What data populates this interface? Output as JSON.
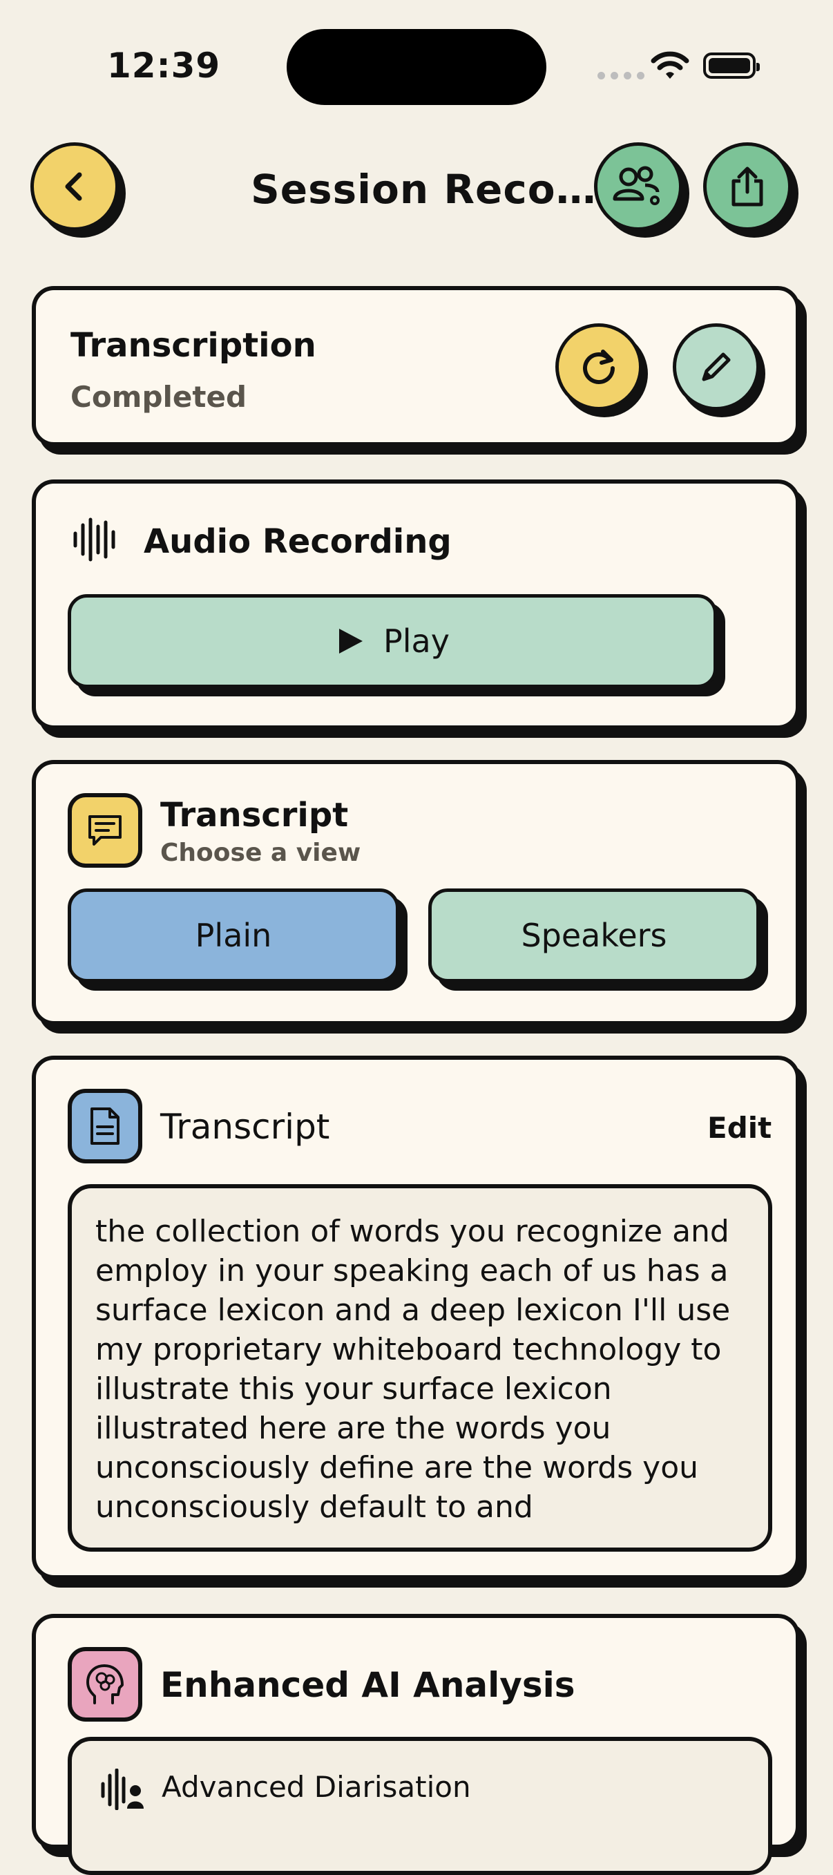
{
  "status_bar": {
    "time": "12:39"
  },
  "header": {
    "title": "Session Reco…"
  },
  "icons": {
    "back": "chevron-left-icon",
    "speakers_settings": "users-gear-icon",
    "share": "share-icon",
    "refresh": "refresh-icon",
    "edit": "pencil-icon",
    "waveform": "waveform-icon",
    "play": "play-icon",
    "chat": "chat-icon",
    "document": "document-icon",
    "brain": "brain-head-icon"
  },
  "transcription_card": {
    "title": "Transcription",
    "status": "Completed"
  },
  "audio_card": {
    "title": "Audio Recording",
    "play_label": "Play"
  },
  "view_card": {
    "title": "Transcript",
    "subtitle": "Choose a view",
    "options": [
      "Plain",
      "Speakers"
    ],
    "selected": "Plain"
  },
  "transcript_card": {
    "title": "Transcript",
    "edit_label": "Edit",
    "text": "the collection of words you recognize and employ in your speaking each of us has a surface lexicon and a deep lexicon I'll use my proprietary whiteboard technology to illustrate this your surface lexicon illustrated here are the words you unconsciously define are the words you unconsciously default to and"
  },
  "ai_card": {
    "title": "Enhanced AI Analysis",
    "item_title": "Advanced Diarisation"
  },
  "colors": {
    "background": "#F4F0E6",
    "card": "#FDF8EF",
    "yellow": "#F2D26A",
    "green": "#7CC397",
    "mint": "#B8DCC9",
    "blue": "#8BB4DB",
    "pink": "#E9A5BE",
    "ink": "#111111"
  }
}
